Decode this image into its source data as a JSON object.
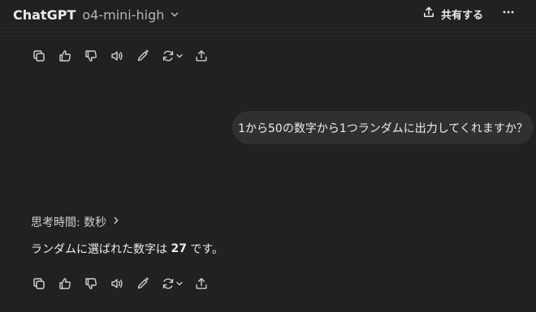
{
  "header": {
    "brand": "ChatGPT",
    "model": "o4-mini-high",
    "share_label": "共有する"
  },
  "icons": {
    "model_dropdown": "chevron-down-icon",
    "share": "share-upload-icon",
    "more": "more-horizontal-icon",
    "copy": "copy-icon",
    "thumbs_up": "thumbs-up-icon",
    "thumbs_down": "thumbs-down-icon",
    "read_aloud": "speaker-icon",
    "edit_canvas": "pen-sparkle-icon",
    "regenerate": "refresh-icon",
    "share_message": "upload-icon",
    "thought_expand": "chevron-right-icon"
  },
  "conversation": {
    "user_message": "1から50の数字から1つランダムに出力してくれますか？",
    "thought_label": "思考時間: 数秒",
    "answer_prefix": "ランダムに選ばれた数字は ",
    "answer_number": "27",
    "answer_suffix": " です。"
  },
  "colors": {
    "background": "#212121",
    "bubble": "#303030",
    "text": "#ececec",
    "muted": "#b4b4b4",
    "icon": "#cfcfcf"
  }
}
